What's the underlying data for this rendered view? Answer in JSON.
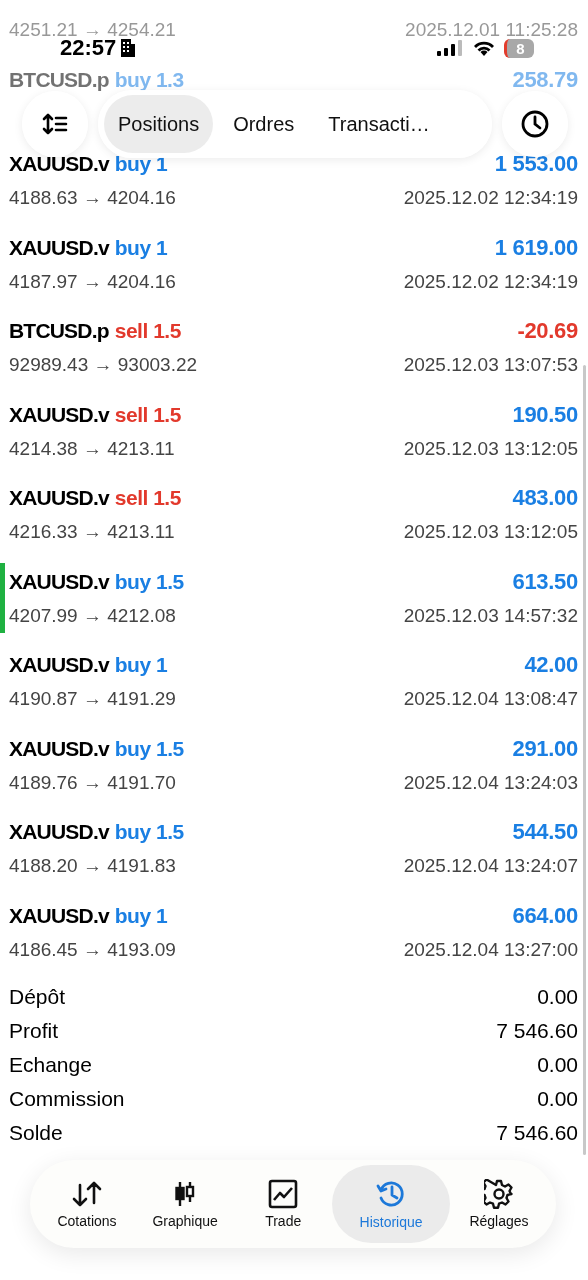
{
  "status_bar": {
    "time": "22:57",
    "battery": "8"
  },
  "faded_rows": [
    {
      "prices": "4251.21 → 4254.21",
      "time": "2025.12.01 11:25:28"
    },
    {
      "symbol": "BTCUSD.p",
      "side": "buy",
      "volume": "1.3",
      "profit": "258.79"
    }
  ],
  "toolbar": {
    "tabs": [
      {
        "label": "Positions",
        "selected": true
      },
      {
        "label": "Ordres",
        "selected": false
      },
      {
        "label": "Transacti…",
        "selected": false
      }
    ]
  },
  "deals": [
    {
      "symbol": "XAUUSD.v",
      "side": "buy",
      "volume": "1",
      "profit": "1 553.00",
      "negative": false,
      "prices": "4188.63 → 4204.16",
      "time": "2025.12.02 12:34:19",
      "selected": false
    },
    {
      "symbol": "XAUUSD.v",
      "side": "buy",
      "volume": "1",
      "profit": "1 619.00",
      "negative": false,
      "prices": "4187.97 → 4204.16",
      "time": "2025.12.02 12:34:19",
      "selected": false
    },
    {
      "symbol": "BTCUSD.p",
      "side": "sell",
      "volume": "1.5",
      "profit": "-20.69",
      "negative": true,
      "prices": "92989.43 → 93003.22",
      "time": "2025.12.03 13:07:53",
      "selected": false
    },
    {
      "symbol": "XAUUSD.v",
      "side": "sell",
      "volume": "1.5",
      "profit": "190.50",
      "negative": false,
      "prices": "4214.38 → 4213.11",
      "time": "2025.12.03 13:12:05",
      "selected": false
    },
    {
      "symbol": "XAUUSD.v",
      "side": "sell",
      "volume": "1.5",
      "profit": "483.00",
      "negative": false,
      "prices": "4216.33 → 4213.11",
      "time": "2025.12.03 13:12:05",
      "selected": false
    },
    {
      "symbol": "XAUUSD.v",
      "side": "buy",
      "volume": "1.5",
      "profit": "613.50",
      "negative": false,
      "prices": "4207.99 → 4212.08",
      "time": "2025.12.03 14:57:32",
      "selected": true
    },
    {
      "symbol": "XAUUSD.v",
      "side": "buy",
      "volume": "1",
      "profit": "42.00",
      "negative": false,
      "prices": "4190.87 → 4191.29",
      "time": "2025.12.04 13:08:47",
      "selected": false
    },
    {
      "symbol": "XAUUSD.v",
      "side": "buy",
      "volume": "1.5",
      "profit": "291.00",
      "negative": false,
      "prices": "4189.76 → 4191.70",
      "time": "2025.12.04 13:24:03",
      "selected": false
    },
    {
      "symbol": "XAUUSD.v",
      "side": "buy",
      "volume": "1.5",
      "profit": "544.50",
      "negative": false,
      "prices": "4188.20 → 4191.83",
      "time": "2025.12.04 13:24:07",
      "selected": false
    },
    {
      "symbol": "XAUUSD.v",
      "side": "buy",
      "volume": "1",
      "profit": "664.00",
      "negative": false,
      "prices": "4186.45 → 4193.09",
      "time": "2025.12.04 13:27:00",
      "selected": false
    }
  ],
  "summary": [
    {
      "label": "Dépôt",
      "value": "0.00"
    },
    {
      "label": "Profit",
      "value": "7 546.60"
    },
    {
      "label": "Echange",
      "value": "0.00"
    },
    {
      "label": "Commission",
      "value": "0.00"
    },
    {
      "label": "Solde",
      "value": "7 546.60"
    }
  ],
  "nav": [
    {
      "label": "Cotations",
      "kind": "arrows",
      "selected": false
    },
    {
      "label": "Graphique",
      "kind": "candles",
      "selected": false
    },
    {
      "label": "Trade",
      "kind": "chart",
      "selected": false
    },
    {
      "label": "Historique",
      "kind": "history",
      "selected": true
    },
    {
      "label": "Réglages",
      "kind": "gear",
      "selected": false
    }
  ]
}
